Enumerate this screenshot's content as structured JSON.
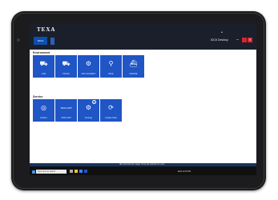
{
  "app": {
    "brand": "TEXA",
    "home_tab": "TEXA",
    "device_name": "IDC5 Desktop",
    "minimize": "–",
    "close": "✕",
    "expand": "▴"
  },
  "sections": {
    "environment": "Environment",
    "service": "Service"
  },
  "environment_tiles": [
    {
      "label": "CAR",
      "icon": "car-icon"
    },
    {
      "label": "TRUCK",
      "icon": "truck-icon"
    },
    {
      "label": "OFF HIGHWAY",
      "icon": "tractor-icon"
    },
    {
      "label": "BIKE",
      "icon": "motorbike-icon"
    },
    {
      "label": "MARINE",
      "icon": "boat-icon"
    }
  ],
  "service_tiles": [
    {
      "label": "Toolbox",
      "icon": "toolbox-icon"
    },
    {
      "label": "TEXA APP",
      "icon": "texa-app-icon",
      "icon_text": "TEXA APP"
    },
    {
      "label": "Settings",
      "icon": "settings-icon",
      "badge": "1"
    },
    {
      "label": "Update Mast",
      "icon": "update-icon"
    }
  ],
  "status_bar": {
    "text": "Idle Stat Monitor stage. Drive all vehicles for sure."
  },
  "taskbar": {
    "search_placeholder": "Type here to search",
    "tray_text": "ENG 12:15 PM"
  },
  "colors": {
    "tile": "#1f55c5",
    "topbar": "#1a1f2b",
    "window_close": "#d8262e"
  }
}
